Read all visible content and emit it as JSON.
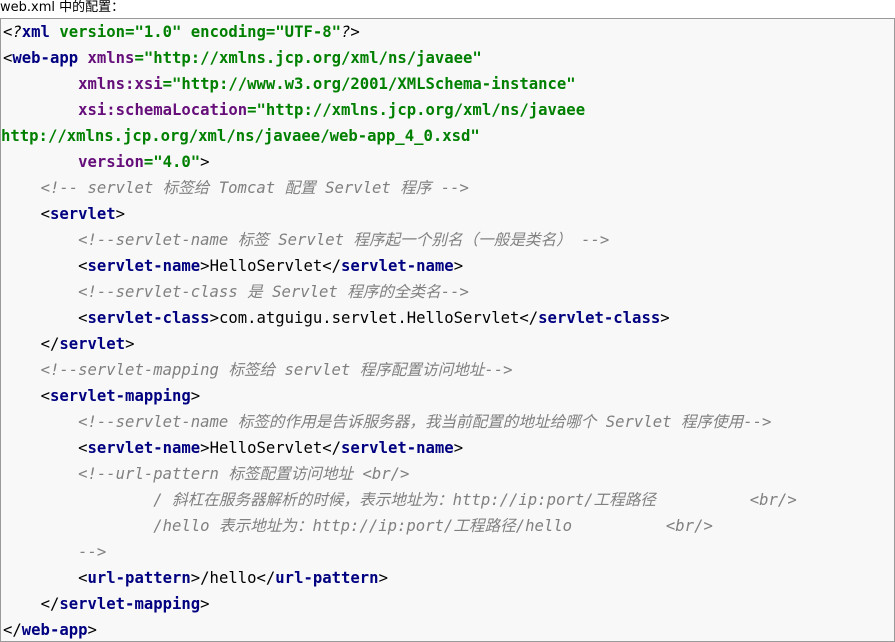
{
  "caption": "web.xml 中的配置：",
  "code": {
    "line1": {
      "open": "<?",
      "tag": "xml",
      "attr1_name": "version",
      "attr1_eq": "=",
      "attr1_value": "\"1.0\"",
      "attr2_name": "encoding",
      "attr2_eq": "=",
      "attr2_value": "\"UTF-8\"",
      "close": "?>"
    },
    "line2": {
      "open": "<",
      "tag": "web-app",
      "attr_name": "xmlns",
      "eq": "=",
      "attr_value": "\"http://xmlns.jcp.org/xml/ns/javaee\""
    },
    "line3": {
      "attr_name": "xmlns:xsi",
      "eq": "=",
      "attr_value": "\"http://www.w3.org/2001/XMLSchema-instance\""
    },
    "line4": {
      "attr_name": "xsi:schemaLocation",
      "eq": "=",
      "attr_value": "\"http://xmlns.jcp.org/xml/ns/javaee"
    },
    "line5": {
      "attr_value": "http://xmlns.jcp.org/xml/ns/javaee/web-app_4_0.xsd\""
    },
    "line6": {
      "attr_name": "version",
      "eq": "=",
      "attr_value": "\"4.0\"",
      "close": ">"
    },
    "line7": {
      "comment": "<!-- servlet 标签给 Tomcat 配置 Servlet 程序 -->"
    },
    "line8": {
      "open": "<",
      "tag": "servlet",
      "close": ">"
    },
    "line9": {
      "comment": "<!--servlet-name 标签 Servlet 程序起一个别名（一般是类名） -->"
    },
    "line10": {
      "open": "<",
      "tag": "servlet-name",
      "close": ">",
      "text": "HelloServlet",
      "end_open": "</",
      "end_tag": "servlet-name",
      "end_close": ">"
    },
    "line11": {
      "comment": "<!--servlet-class 是 Servlet 程序的全类名-->"
    },
    "line12": {
      "open": "<",
      "tag": "servlet-class",
      "close": ">",
      "text": "com.atguigu.servlet.HelloServlet",
      "end_open": "</",
      "end_tag": "servlet-class",
      "end_close": ">"
    },
    "line13": {
      "open": "</",
      "tag": "servlet",
      "close": ">"
    },
    "line14": {
      "comment": "<!--servlet-mapping 标签给 servlet 程序配置访问地址-->"
    },
    "line15": {
      "open": "<",
      "tag": "servlet-mapping",
      "close": ">"
    },
    "line16": {
      "comment": "<!--servlet-name 标签的作用是告诉服务器，我当前配置的地址给哪个 Servlet 程序使用-->"
    },
    "line17": {
      "open": "<",
      "tag": "servlet-name",
      "close": ">",
      "text": "HelloServlet",
      "end_open": "</",
      "end_tag": "servlet-name",
      "end_close": ">"
    },
    "line18": {
      "comment": "<!--url-pattern 标签配置访问地址 <br/>"
    },
    "line19": {
      "comment": "/ 斜杠在服务器解析的时候，表示地址为：http://ip:port/工程路径          <br/>"
    },
    "line20": {
      "comment": "/hello 表示地址为：http://ip:port/工程路径/hello          <br/>"
    },
    "line21": {
      "comment": "-->"
    },
    "line22": {
      "open": "<",
      "tag": "url-pattern",
      "close": ">",
      "text": "/hello",
      "end_open": "</",
      "end_tag": "url-pattern",
      "end_close": ">"
    },
    "line23": {
      "open": "</",
      "tag": "servlet-mapping",
      "close": ">"
    },
    "line24": {
      "open": "</",
      "tag": "web-app",
      "close": ">"
    }
  }
}
